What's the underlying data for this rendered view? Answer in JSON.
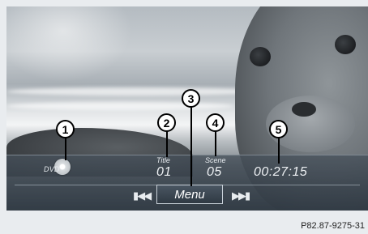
{
  "player": {
    "source_label": "DVD",
    "title_label": "Title",
    "title_value": "01",
    "scene_label": "Scene",
    "scene_value": "05",
    "elapsed_time": "00:27:15",
    "menu_label": "Menu",
    "prev_icon": "skip-back-icon",
    "next_icon": "skip-forward-icon"
  },
  "callouts": [
    "1",
    "2",
    "3",
    "4",
    "5"
  ],
  "figure_ref": "P82.87-9275-31"
}
